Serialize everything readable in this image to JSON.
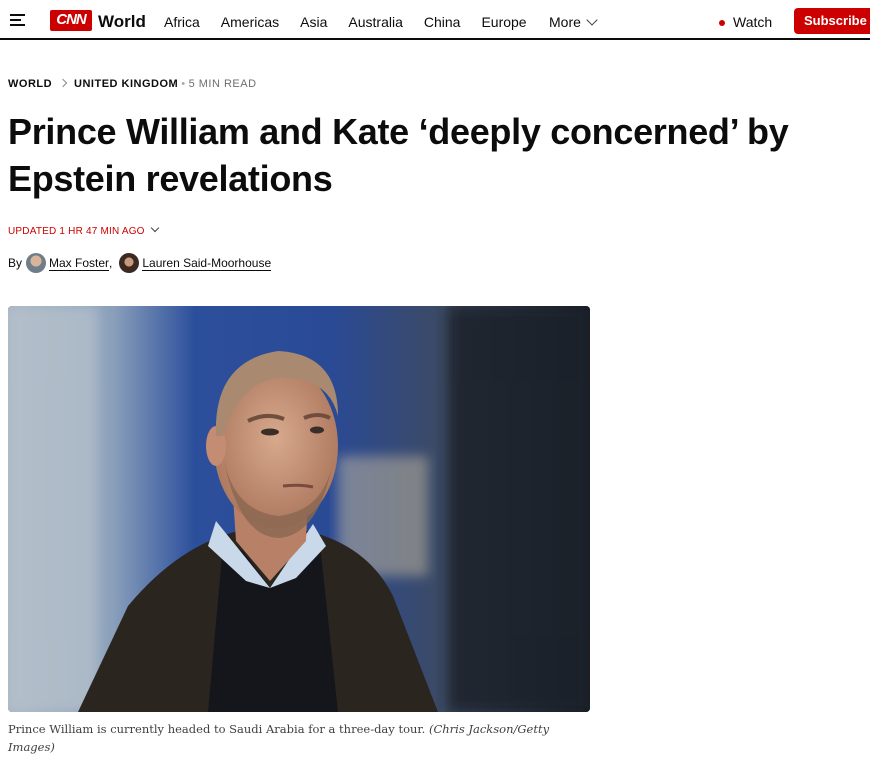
{
  "header": {
    "logo_text": "CNN",
    "section": "World",
    "nav": [
      "Africa",
      "Americas",
      "Asia",
      "Australia",
      "China",
      "Europe"
    ],
    "more_label": "More",
    "watch_label": "Watch",
    "subscribe_label": "Subscribe",
    "brand_color": "#cc0000"
  },
  "breadcrumb": {
    "section": "WORLD",
    "subsection": "UNITED KINGDOM",
    "read_time": "5 MIN READ"
  },
  "article": {
    "headline_line1": "Prince William and Kate ‘deeply concerned’ by",
    "headline_line2": "Epstein revelations",
    "updated": "UPDATED 1 HR 47 MIN AGO",
    "by_label": "By",
    "authors": [
      "Max Foster",
      "Lauren Said-Moorhouse"
    ],
    "author_separator": ","
  },
  "image": {
    "caption": "Prince William is currently headed to Saudi Arabia for a three-day tour.",
    "credit": "(Chris Jackson/Getty Images)"
  },
  "icons": {
    "menu": "hamburger-menu-icon",
    "more": "chevron-down-icon",
    "live": "live-dot-icon"
  }
}
